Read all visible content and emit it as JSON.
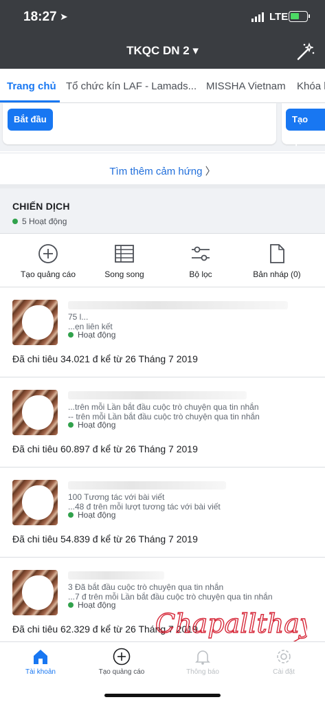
{
  "status_bar": {
    "time": "18:27",
    "network": "LTE"
  },
  "nav": {
    "title": "TKQC DN 2 ▾",
    "wand_icon": "magic-wand-icon"
  },
  "tabs": [
    {
      "label": "Trang chủ",
      "active": true
    },
    {
      "label": "Tổ chức kín LAF - Lamads..."
    },
    {
      "label": "MISSHA Vietnam"
    },
    {
      "label": "Khóa h"
    }
  ],
  "cards": {
    "start_label": "Bắt đầu",
    "create_label": "Tạo quản"
  },
  "find_more": "Tìm thêm cảm hứng",
  "campaigns_section": {
    "title": "CHIẾN DỊCH",
    "active_count": "5 Hoạt động"
  },
  "actions": [
    {
      "label": "Tạo quảng cáo",
      "icon": "plus-circle-icon"
    },
    {
      "label": "Song song",
      "icon": "grid-list-icon"
    },
    {
      "label": "Bộ lọc",
      "icon": "filter-sliders-icon"
    },
    {
      "label": "Bản nháp (0)",
      "icon": "draft-document-icon"
    }
  ],
  "campaigns": [
    {
      "line1": "75 l...",
      "line2": "...ẹn liên kết",
      "status": "Hoạt động",
      "spent": "Đã chi tiêu 34.021 đ kể từ 26 Tháng 7 2019"
    },
    {
      "line1": "...trên mỗi Lần bắt đầu cuộc trò chuyện qua tin nhắn",
      "line2": "-- trên mỗi Lần bắt đầu cuộc trò chuyện qua tin nhắn",
      "status": "Hoạt động",
      "spent": "Đã chi tiêu 60.897 đ kể từ 26 Tháng 7 2019"
    },
    {
      "line1": "100 Tương tác với bài viết",
      "line2": "...48 đ trên mỗi lượt tương tác với bài viết",
      "status": "Hoạt động",
      "spent": "Đã chi tiêu 54.839 đ kể từ 26 Tháng 7 2019"
    },
    {
      "line1": "3 Đã bắt đầu cuộc trò chuyện qua tin nhắn",
      "line2": "...7 đ trên mỗi Lần bắt đầu cuộc trò chuyện qua tin nhắn",
      "status": "Hoạt động",
      "spent": "Đã chi tiêu 62.329 đ kể từ 26 Tháng 7 2019"
    }
  ],
  "bottom_tabs": [
    {
      "label": "Tài khoản",
      "icon": "home-icon",
      "active": true
    },
    {
      "label": "Tạo quảng cáo",
      "icon": "plus-circle-icon"
    },
    {
      "label": "Thông báo",
      "icon": "bell-icon"
    },
    {
      "label": "Cài đặt",
      "icon": "gear-icon"
    }
  ],
  "watermark": "Chapallthay",
  "colors": {
    "accent": "#1877f2",
    "header": "#3a3d41",
    "active_dot": "#31a24c"
  }
}
